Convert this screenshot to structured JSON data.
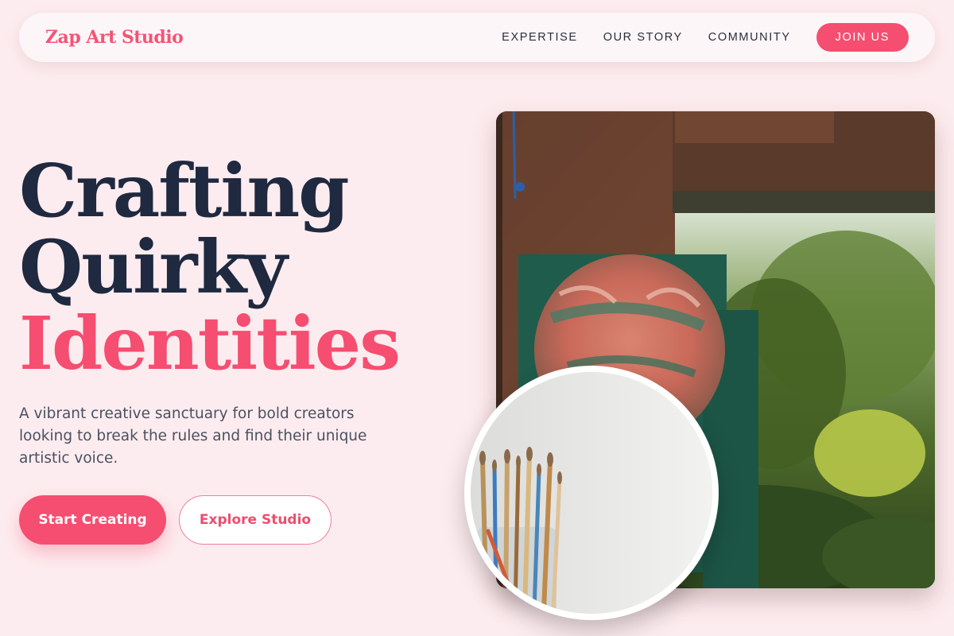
{
  "header": {
    "logo": "Zap Art Studio",
    "nav": [
      "EXPERTISE",
      "OUR STORY",
      "COMMUNITY"
    ],
    "cta": "JOIN US"
  },
  "hero": {
    "title_line1": "Crafting",
    "title_line2": "Quirky",
    "title_line3": "Identities",
    "description": "A vibrant creative sanctuary for bold creators looking to break the rules and find their unique artistic voice.",
    "primary_button": "Start Creating",
    "secondary_button": "Explore Studio"
  },
  "images": {
    "main": "painting-in-garden-window-image",
    "secondary": "paintbrushes-jar-image"
  },
  "colors": {
    "accent": "#f54e70",
    "background": "#fdecef",
    "heading": "#1f2940",
    "body_text": "#4a5061"
  }
}
